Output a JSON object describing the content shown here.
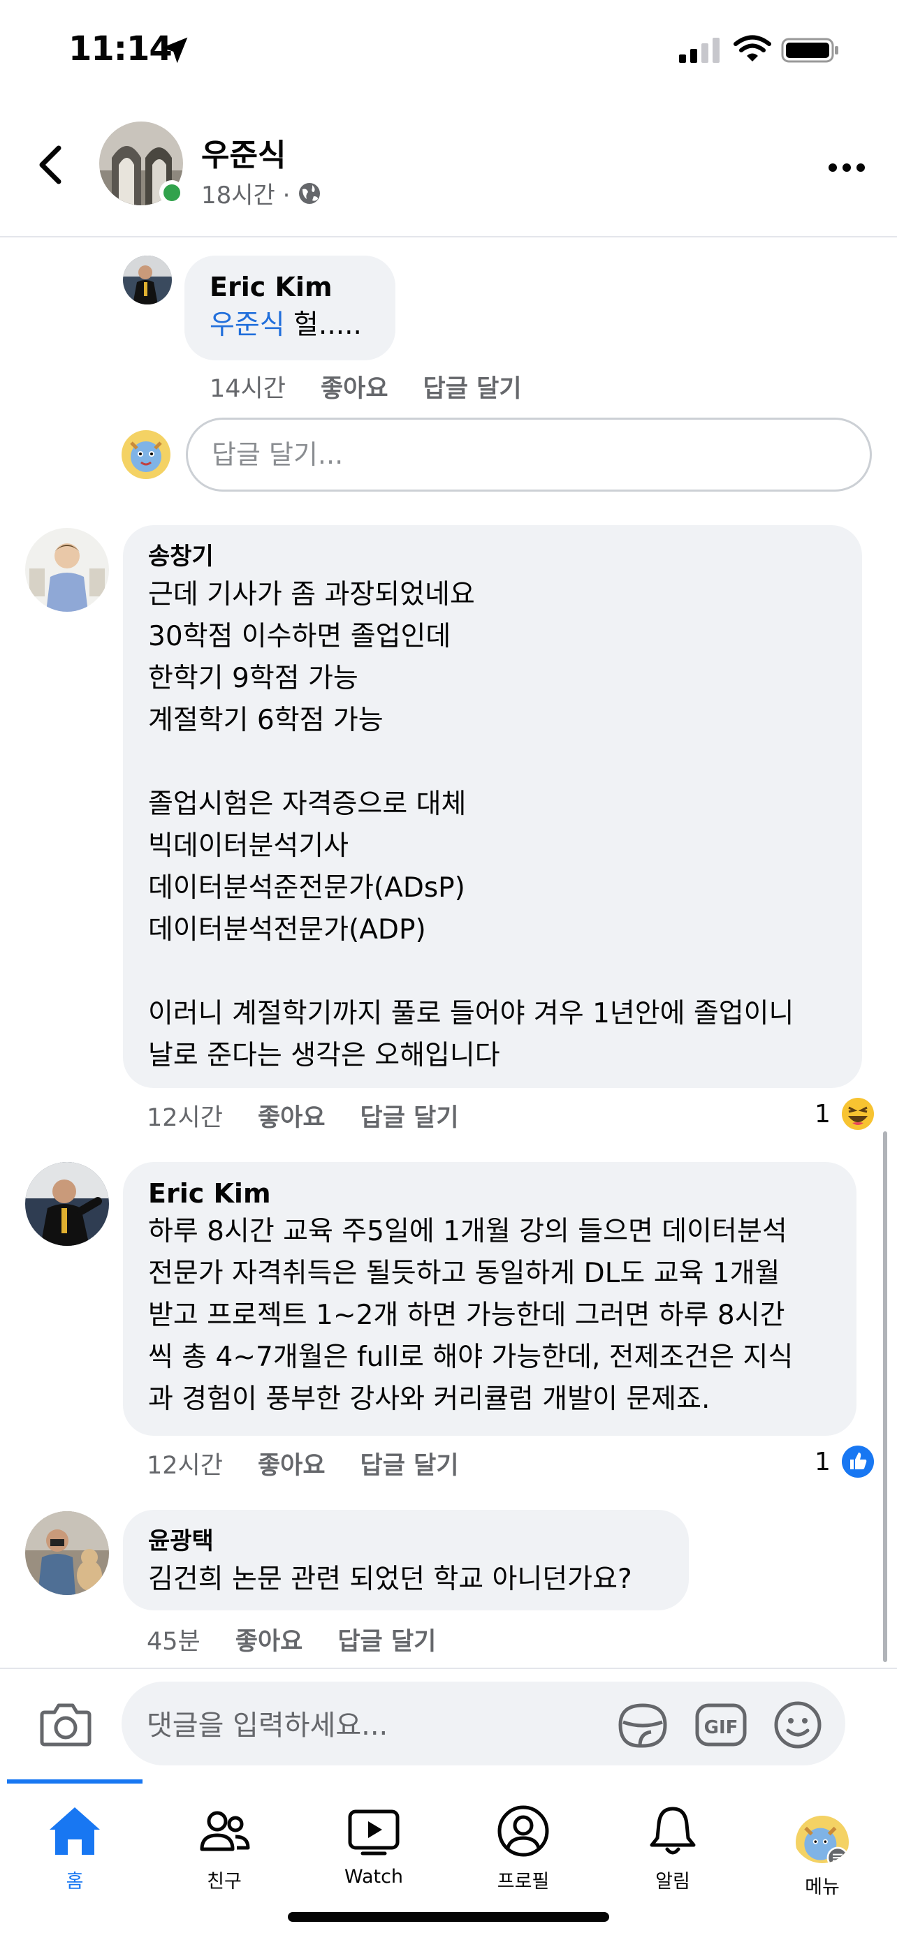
{
  "status_bar": {
    "time": "11:14"
  },
  "header": {
    "post_author": "우준식",
    "post_time": "18시간 ·"
  },
  "comments": [
    {
      "author": "Eric Kim",
      "mention": "우준식",
      "text": " 헐.....",
      "time": "14시간",
      "like_label": "좋아요",
      "reply_label": "답글 달기"
    },
    {
      "author": "송창기",
      "text": "근데 기사가 좀 과장되었네요\n30학점 이수하면 졸업인데\n한학기 9학점 가능\n계절학기 6학점 가능\n\n졸업시험은 자격증으로 대체\n빅데이터분석기사\n데이터분석준전문가(ADsP)\n데이터분석전문가(ADP)\n\n이러니 계절학기까지 풀로 들어야 겨우 1년안에 졸업이니\n날로 준다는 생각은 오해입니다",
      "time": "12시간",
      "like_label": "좋아요",
      "reply_label": "답글 달기",
      "reaction_count": "1",
      "reaction_icon": "haha-emoji-icon"
    },
    {
      "author": "Eric Kim",
      "text": "하루 8시간 교육 주5일에 1개월 강의 들으면 데이터분석\n전문가 자격취득은 될듯하고 동일하게 DL도 교육 1개월\n받고 프로젝트 1~2개 하면 가능한데 그러면 하루 8시간\n씩 총 4~7개월은 full로 해야 가능한데, 전제조건은 지식\n과 경험이 풍부한 강사와 커리큘럼 개발이 문제죠.",
      "time": "12시간",
      "like_label": "좋아요",
      "reply_label": "답글 달기",
      "reaction_count": "1",
      "reaction_icon": "like-thumb-icon"
    },
    {
      "author": "윤광택",
      "text": "김건희 논문 관련 되었던 학교 아니던가요?",
      "time": "45분",
      "like_label": "좋아요",
      "reply_label": "답글 달기"
    }
  ],
  "reply_input": {
    "placeholder": "답글 달기..."
  },
  "composer": {
    "placeholder": "댓글을 입력하세요..."
  },
  "tabs": [
    {
      "label": "홈",
      "icon": "home-icon",
      "active": true
    },
    {
      "label": "친구",
      "icon": "friends-icon"
    },
    {
      "label": "Watch",
      "icon": "watch-icon"
    },
    {
      "label": "프로필",
      "icon": "profile-icon"
    },
    {
      "label": "알림",
      "icon": "bell-icon"
    },
    {
      "label": "메뉴",
      "icon": "menu-avatar-icon"
    }
  ],
  "colors": {
    "accent": "#1877f2",
    "mention": "#216fdb",
    "bubble": "#f0f2f5",
    "online": "#31a24c",
    "secondary_text": "#65676b"
  }
}
